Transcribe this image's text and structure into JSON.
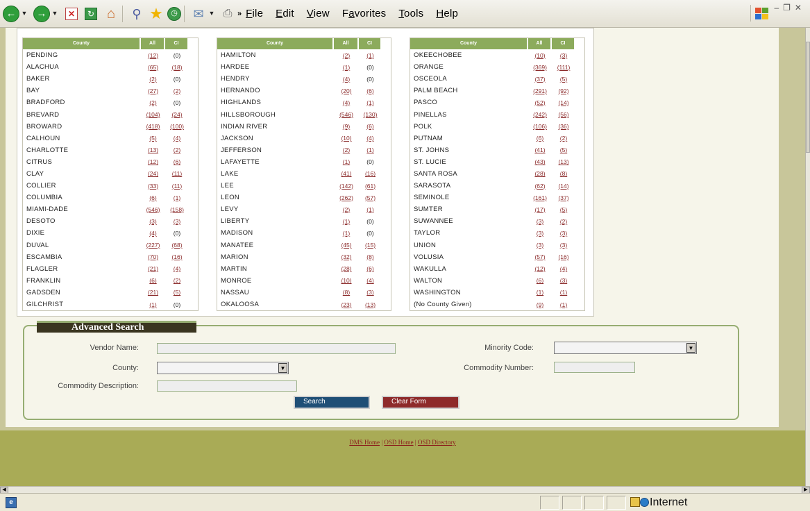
{
  "menu": {
    "items": [
      "File",
      "Edit",
      "View",
      "Favorites",
      "Tools",
      "Help"
    ],
    "underlines": [
      0,
      0,
      0,
      1,
      0,
      0
    ]
  },
  "toolbar": {
    "overflow": "»"
  },
  "county_header": {
    "county": "County",
    "all": "All",
    "ci": "CI"
  },
  "counties": [
    [
      [
        "PENDING",
        "(12)",
        "(0)"
      ],
      [
        "ALACHUA",
        "(65)",
        "(18)"
      ],
      [
        "BAKER",
        "(2)",
        "(0)"
      ],
      [
        "BAY",
        "(27)",
        "(2)"
      ],
      [
        "BRADFORD",
        "(2)",
        "(0)"
      ],
      [
        "BREVARD",
        "(104)",
        "(24)"
      ],
      [
        "BROWARD",
        "(418)",
        "(100)"
      ],
      [
        "CALHOUN",
        "(5)",
        "(4)"
      ],
      [
        "CHARLOTTE",
        "(13)",
        "(2)"
      ],
      [
        "CITRUS",
        "(12)",
        "(6)"
      ],
      [
        "CLAY",
        "(24)",
        "(11)"
      ],
      [
        "COLLIER",
        "(33)",
        "(11)"
      ],
      [
        "COLUMBIA",
        "(6)",
        "(1)"
      ],
      [
        "MIAMI-DADE",
        "(546)",
        "(158)"
      ],
      [
        "DESOTO",
        "(3)",
        "(3)"
      ],
      [
        "DIXIE",
        "(4)",
        "(0)"
      ],
      [
        "DUVAL",
        "(227)",
        "(68)"
      ],
      [
        "ESCAMBIA",
        "(70)",
        "(16)"
      ],
      [
        "FLAGLER",
        "(21)",
        "(4)"
      ],
      [
        "FRANKLIN",
        "(6)",
        "(2)"
      ],
      [
        "GADSDEN",
        "(21)",
        "(5)"
      ],
      [
        "GILCHRIST",
        "(1)",
        "(0)"
      ]
    ],
    [
      [
        "HAMILTON",
        "(2)",
        "(1)"
      ],
      [
        "HARDEE",
        "(1)",
        "(0)"
      ],
      [
        "HENDRY",
        "(4)",
        "(0)"
      ],
      [
        "HERNANDO",
        "(20)",
        "(6)"
      ],
      [
        "HIGHLANDS",
        "(4)",
        "(1)"
      ],
      [
        "HILLSBOROUGH",
        "(546)",
        "(130)"
      ],
      [
        "INDIAN RIVER",
        "(9)",
        "(6)"
      ],
      [
        "JACKSON",
        "(10)",
        "(4)"
      ],
      [
        "JEFFERSON",
        "(2)",
        "(1)"
      ],
      [
        "LAFAYETTE",
        "(1)",
        "(0)"
      ],
      [
        "LAKE",
        "(41)",
        "(16)"
      ],
      [
        "LEE",
        "(142)",
        "(61)"
      ],
      [
        "LEON",
        "(262)",
        "(57)"
      ],
      [
        "LEVY",
        "(2)",
        "(1)"
      ],
      [
        "LIBERTY",
        "(1)",
        "(0)"
      ],
      [
        "MADISON",
        "(1)",
        "(0)"
      ],
      [
        "MANATEE",
        "(45)",
        "(15)"
      ],
      [
        "MARION",
        "(32)",
        "(8)"
      ],
      [
        "MARTIN",
        "(28)",
        "(6)"
      ],
      [
        "MONROE",
        "(10)",
        "(4)"
      ],
      [
        "NASSAU",
        "(8)",
        "(3)"
      ],
      [
        "OKALOOSA",
        "(23)",
        "(13)"
      ]
    ],
    [
      [
        "OKEECHOBEE",
        "(10)",
        "(3)"
      ],
      [
        "ORANGE",
        "(369)",
        "(111)"
      ],
      [
        "OSCEOLA",
        "(37)",
        "(5)"
      ],
      [
        "PALM BEACH",
        "(291)",
        "(92)"
      ],
      [
        "PASCO",
        "(52)",
        "(14)"
      ],
      [
        "PINELLAS",
        "(242)",
        "(56)"
      ],
      [
        "POLK",
        "(106)",
        "(36)"
      ],
      [
        "PUTNAM",
        "(6)",
        "(2)"
      ],
      [
        "ST. JOHNS",
        "(41)",
        "(5)"
      ],
      [
        "ST. LUCIE",
        "(43)",
        "(13)"
      ],
      [
        "SANTA ROSA",
        "(28)",
        "(8)"
      ],
      [
        "SARASOTA",
        "(62)",
        "(14)"
      ],
      [
        "SEMINOLE",
        "(161)",
        "(37)"
      ],
      [
        "SUMTER",
        "(17)",
        "(5)"
      ],
      [
        "SUWANNEE",
        "(3)",
        "(2)"
      ],
      [
        "TAYLOR",
        "(3)",
        "(3)"
      ],
      [
        "UNION",
        "(3)",
        "(3)"
      ],
      [
        "VOLUSIA",
        "(57)",
        "(16)"
      ],
      [
        "WAKULLA",
        "(12)",
        "(4)"
      ],
      [
        "WALTON",
        "(6)",
        "(3)"
      ],
      [
        "WASHINGTON",
        "(1)",
        "(1)"
      ],
      [
        "(No County Given)",
        "(9)",
        "(1)"
      ]
    ]
  ],
  "advanced_search": {
    "title": "Advanced Search",
    "vendor_label": "Vendor Name:",
    "vendor_value": "",
    "county_label": "County:",
    "county_selected": "",
    "commodity_desc_label": "Commodity Description:",
    "commodity_desc_value": "",
    "minority_label": "Minority Code:",
    "minority_selected": "",
    "commodity_num_label": "Commodity Number:",
    "commodity_num_value": "",
    "search_button": "Search",
    "clear_button": "Clear Form"
  },
  "footer": {
    "links": [
      "DMS Home",
      "OSD Home",
      "OSD Directory"
    ],
    "separator": "|"
  },
  "status": {
    "zone": "Internet"
  },
  "colors": {
    "header_green": "#8cab5c",
    "link_red": "#8b2a2a",
    "search_blue": "#1f4f76",
    "clear_red": "#8e2a2a",
    "footer_olive": "#a9ab56",
    "border_green": "#96ad72"
  },
  "icons": {
    "back": "back-arrow-icon",
    "forward": "forward-arrow-icon",
    "stop": "stop-icon",
    "refresh": "refresh-icon",
    "home": "home-icon",
    "search": "search-icon",
    "favorites": "favorites-star-icon",
    "history": "history-icon",
    "mail": "mail-icon",
    "print": "print-icon"
  }
}
